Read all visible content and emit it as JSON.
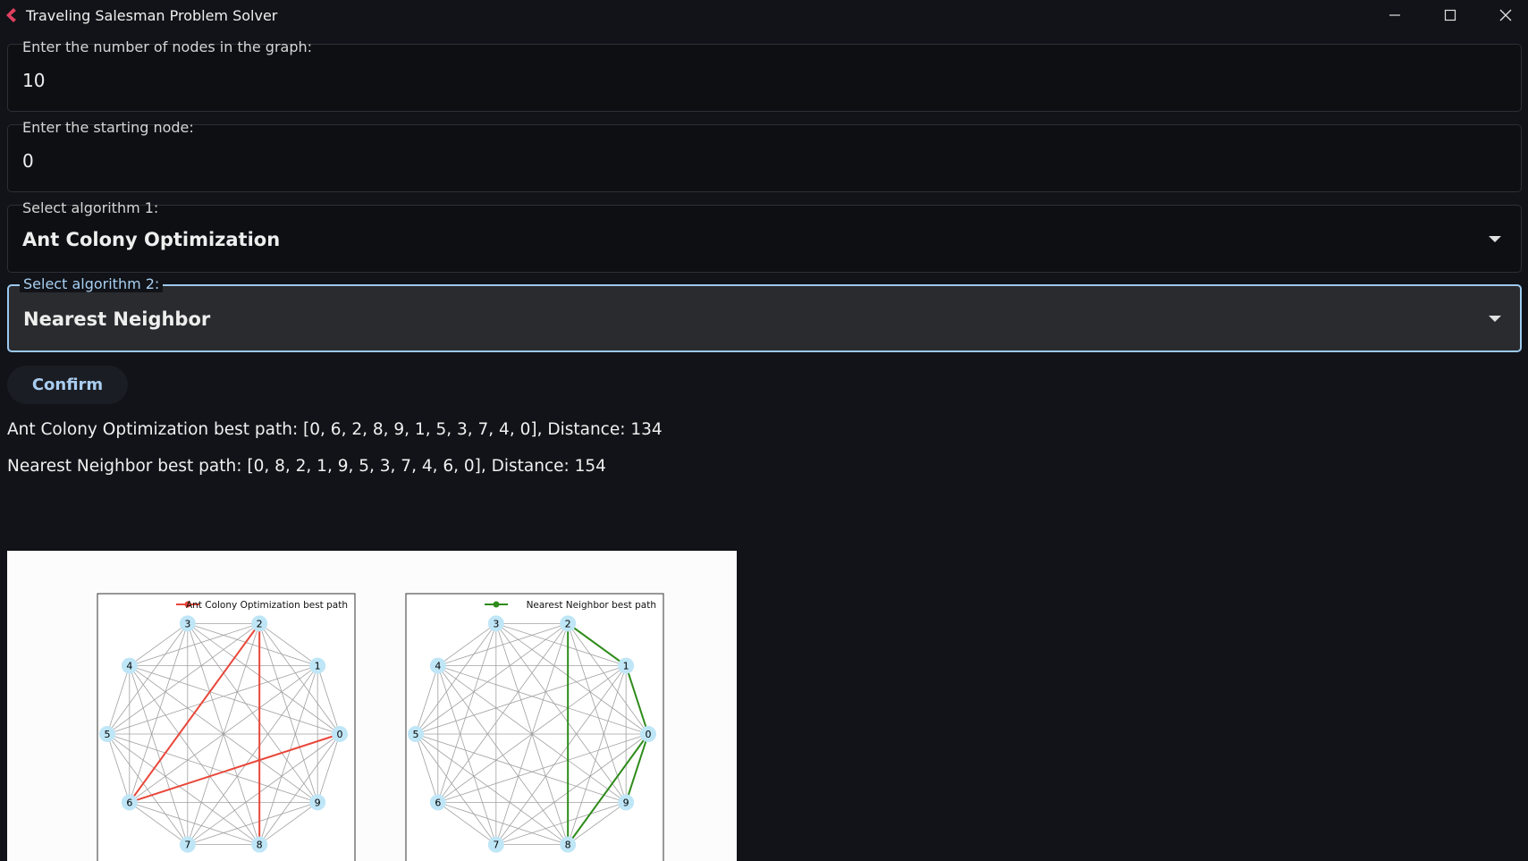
{
  "window": {
    "title": "Traveling Salesman Problem Solver"
  },
  "form": {
    "nodes_label": "Enter the number of nodes in the graph:",
    "nodes_value": "10",
    "start_label": "Enter the starting node:",
    "start_value": "0",
    "algo1_label": "Select algorithm 1:",
    "algo1_value": "Ant Colony Optimization",
    "algo2_label": "Select algorithm 2:",
    "algo2_value": "Nearest Neighbor",
    "confirm_label": "Confirm"
  },
  "results": {
    "line1": "Ant Colony Optimization best path: [0, 6, 2, 8, 9, 1, 5, 3, 7, 4, 0], Distance: 134",
    "line2": "Nearest Neighbor best path: [0, 8, 2, 1, 9, 5, 3, 7, 4, 6, 0], Distance: 154"
  },
  "colors": {
    "aco_path": "#e8473a",
    "nn_path": "#2e8b1a",
    "node_fill": "#bfe6f7",
    "edge": "#a0a0a0"
  },
  "chart_data": [
    {
      "type": "graph",
      "legend": "Ant Colony Optimization best path",
      "nodes": [
        0,
        1,
        2,
        3,
        4,
        5,
        6,
        7,
        8,
        9
      ],
      "highlighted_edges": [
        [
          2,
          6
        ],
        [
          0,
          6
        ],
        [
          2,
          8
        ]
      ]
    },
    {
      "type": "graph",
      "legend": "Nearest Neighbor best path",
      "nodes": [
        0,
        1,
        2,
        3,
        4,
        5,
        6,
        7,
        8,
        9
      ],
      "highlighted_edges": [
        [
          2,
          8
        ],
        [
          2,
          1
        ],
        [
          0,
          8
        ],
        [
          0,
          9
        ],
        [
          1,
          0
        ]
      ]
    }
  ]
}
